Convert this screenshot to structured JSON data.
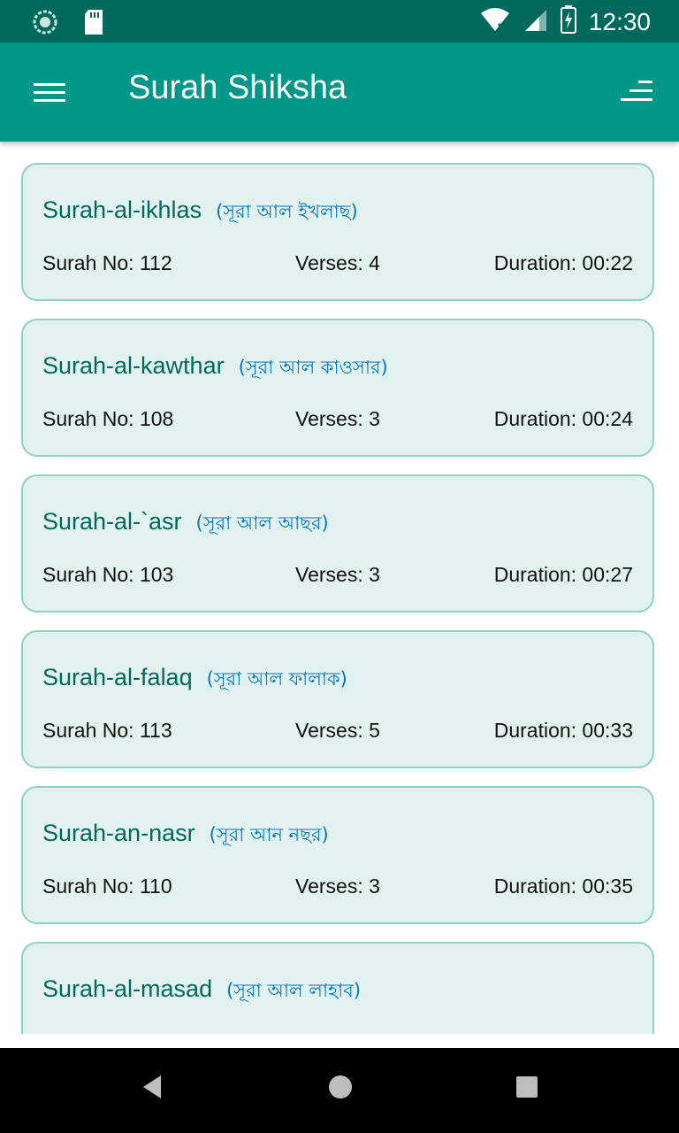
{
  "status_bar": {
    "time": "12:30",
    "icons": [
      "sync-icon",
      "sd-card-icon",
      "wifi-icon",
      "signal-icon",
      "battery-charging-icon"
    ]
  },
  "app_bar": {
    "title": "Surah Shiksha",
    "menu_icon": "hamburger-menu-icon",
    "sort_icon": "sort-icon"
  },
  "surahs": [
    {
      "name": "Surah-al-ikhlas",
      "bangla": "(সূরা আল ইখলাছ)",
      "number": "Surah No: 112",
      "verses": "Verses: 4",
      "duration": "Duration: 00:22"
    },
    {
      "name": "Surah-al-kawthar",
      "bangla": "(সূরা আল কাওসার)",
      "number": "Surah No: 108",
      "verses": "Verses: 3",
      "duration": "Duration: 00:24"
    },
    {
      "name": "Surah-al-`asr",
      "bangla": "(সূরা আল আছর)",
      "number": "Surah No: 103",
      "verses": "Verses: 3",
      "duration": "Duration: 00:27"
    },
    {
      "name": "Surah-al-falaq",
      "bangla": "(সূরা আল ফালাক)",
      "number": "Surah No: 113",
      "verses": "Verses: 5",
      "duration": "Duration: 00:33"
    },
    {
      "name": "Surah-an-nasr",
      "bangla": "(সূরা আন নছর)",
      "number": "Surah No: 110",
      "verses": "Verses: 3",
      "duration": "Duration: 00:35"
    },
    {
      "name": "Surah-al-masad",
      "bangla": "(সূরা আল লাহাব)",
      "number": "",
      "verses": "",
      "duration": ""
    }
  ],
  "colors": {
    "status_bar": "#00695c",
    "app_bar": "#009688",
    "card_bg": "#e1f2f0",
    "card_border": "#8fd1c4",
    "name_text": "#00695c",
    "bangla_text": "#0277bd"
  },
  "nav_bar": {
    "back_icon": "back-triangle-icon",
    "home_icon": "home-circle-icon",
    "recents_icon": "recents-square-icon"
  }
}
